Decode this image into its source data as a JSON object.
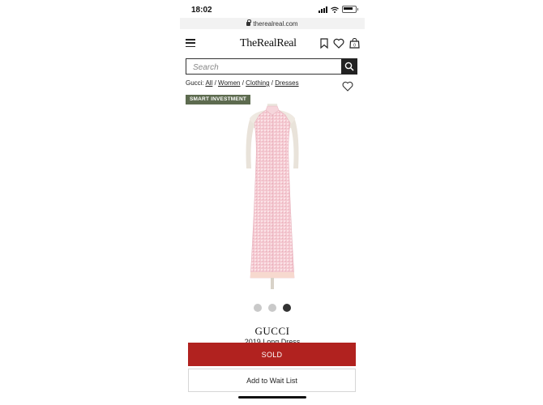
{
  "status_bar": {
    "time": "18:02"
  },
  "browser": {
    "url": "therealreal.com"
  },
  "header": {
    "logo": "TheRealReal"
  },
  "search": {
    "placeholder": "Search"
  },
  "breadcrumb": {
    "prefix": "Gucci:",
    "items": [
      "All",
      "Women",
      "Clothing",
      "Dresses"
    ],
    "separator": "/"
  },
  "badge": {
    "label": "SMART INVESTMENT"
  },
  "carousel": {
    "total": 3,
    "active": 3
  },
  "product": {
    "brand": "GUCCI",
    "name": "2019 Long Dress"
  },
  "actions": {
    "sold_label": "SOLD",
    "wait_list_label": "Add to Wait List"
  },
  "colors": {
    "sold": "#b1221f",
    "badge": "#5d6b4f",
    "dress": "#f3c7cf"
  }
}
